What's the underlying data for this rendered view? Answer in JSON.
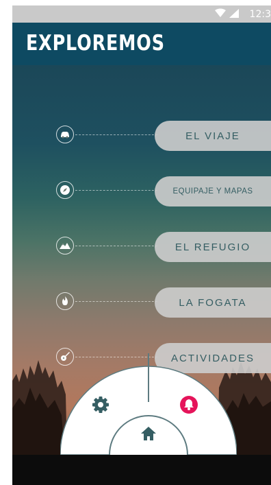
{
  "status_bar": {
    "time": "12:3"
  },
  "app_bar": {
    "title": "EXPLOREMOS"
  },
  "menu_items": [
    {
      "label": "EL VIAJE",
      "icon": "car-icon"
    },
    {
      "label": "EQUIPAJE Y MAPAS",
      "icon": "compass-icon"
    },
    {
      "label": "EL REFUGIO",
      "icon": "mountain-icon"
    },
    {
      "label": "LA FOGATA",
      "icon": "fire-icon"
    },
    {
      "label": "ACTIVIDADES",
      "icon": "guitar-icon"
    }
  ],
  "fab_menu": {
    "left": "settings-gear-icon",
    "right": "notification-bell-icon",
    "center": "home-icon"
  },
  "colors": {
    "app_bar": "#0e4a62",
    "pill_text": "#355e63",
    "bell_accent": "#e5145a",
    "icon_dark": "#355e63"
  }
}
